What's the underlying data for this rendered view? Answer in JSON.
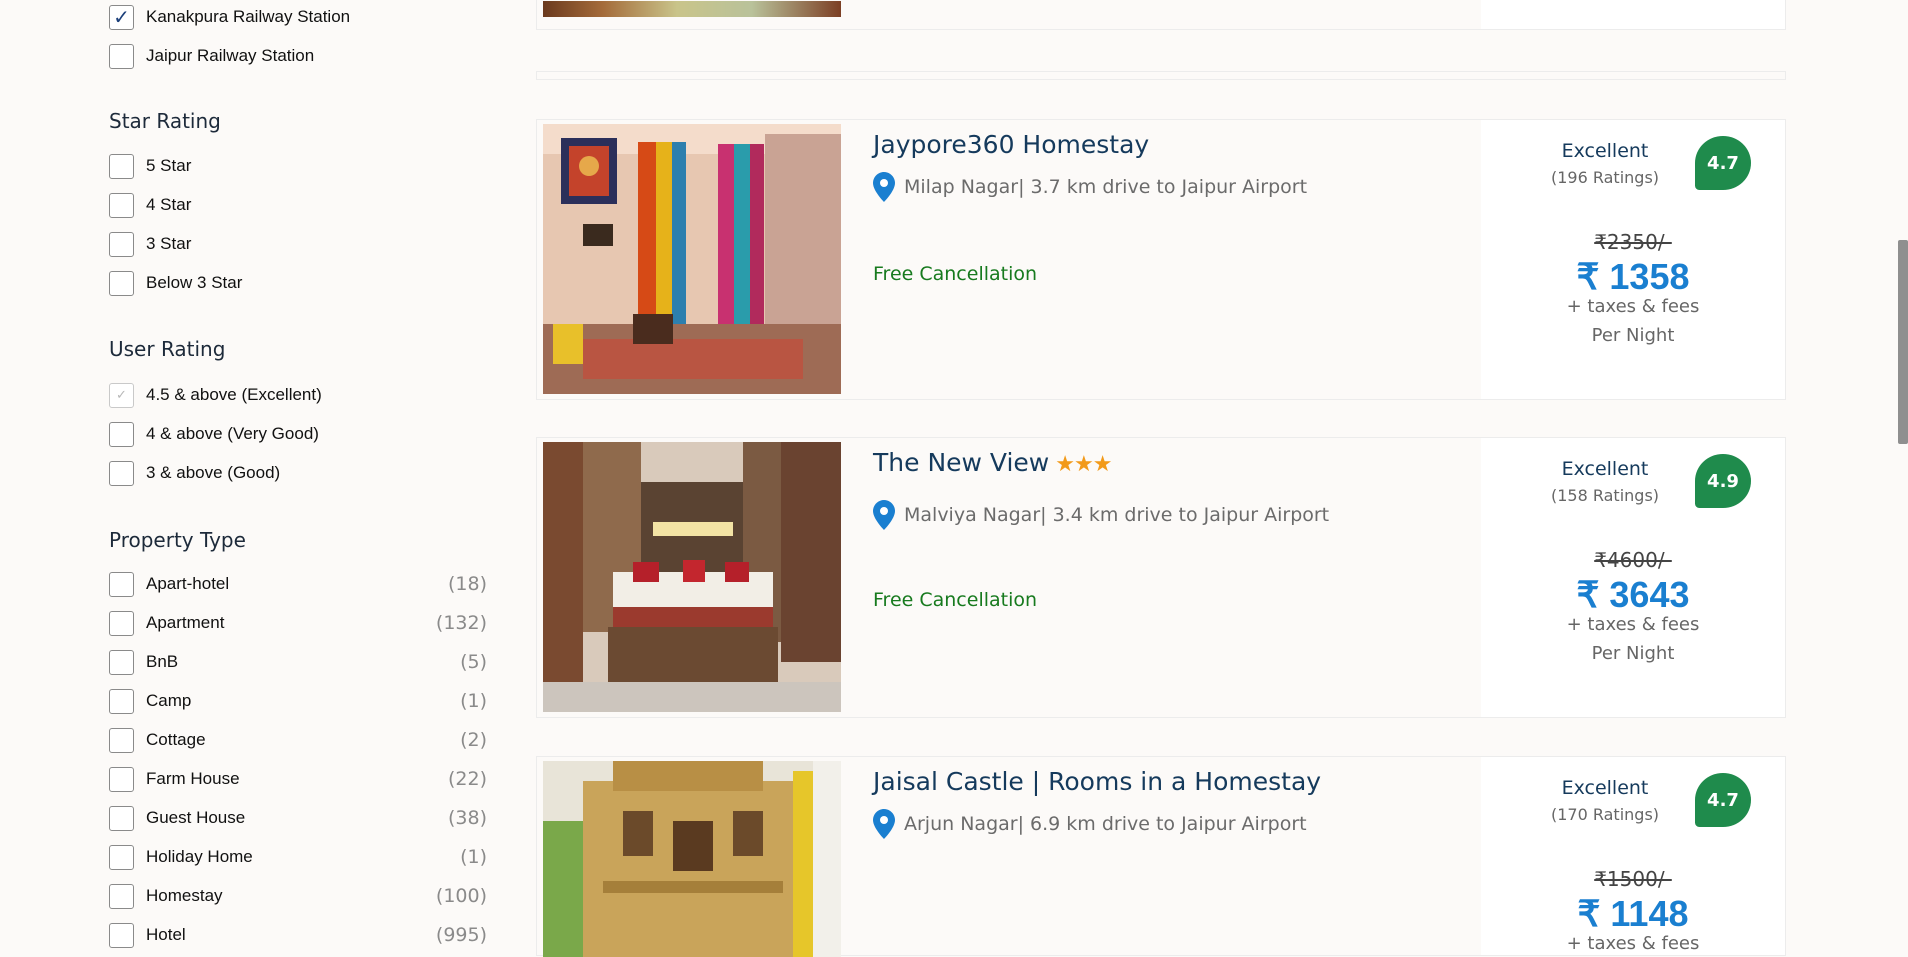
{
  "filters": {
    "station_items": [
      {
        "label": "Kanakpura Railway Station",
        "checked": true
      },
      {
        "label": "Jaipur Railway Station",
        "checked": false
      }
    ],
    "star_rating": {
      "title": "Star Rating",
      "items": [
        "5 Star",
        "4 Star",
        "3 Star",
        "Below 3 Star"
      ]
    },
    "user_rating": {
      "title": "User Rating",
      "items": [
        "4.5 & above (Excellent)",
        "4 & above (Very Good)",
        "3 & above (Good)"
      ]
    },
    "property_type": {
      "title": "Property Type",
      "items": [
        {
          "label": "Apart-hotel",
          "count": "(18)"
        },
        {
          "label": "Apartment",
          "count": "(132)"
        },
        {
          "label": "BnB",
          "count": "(5)"
        },
        {
          "label": "Camp",
          "count": "(1)"
        },
        {
          "label": "Cottage",
          "count": "(2)"
        },
        {
          "label": "Farm House",
          "count": "(22)"
        },
        {
          "label": "Guest House",
          "count": "(38)"
        },
        {
          "label": "Holiday Home",
          "count": "(1)"
        },
        {
          "label": "Homestay",
          "count": "(100)"
        },
        {
          "label": "Hotel",
          "count": "(995)"
        }
      ]
    },
    "check_mark": "✓"
  },
  "listings": [
    {
      "name": "Jaypore360 Homestay",
      "stars": "",
      "location": "Milap Nagar| 3.7 km drive to Jaipur Airport",
      "free_cancellation": "Free Cancellation",
      "rating_word": "Excellent",
      "rating_count": "(196 Ratings)",
      "score": "4.7",
      "old_price": "₹2350/-",
      "price": "₹ 1358",
      "taxes": "+ taxes & fees",
      "per_night": "Per Night"
    },
    {
      "name": "The New View",
      "stars": "★★★",
      "location": "Malviya Nagar| 3.4 km drive to Jaipur Airport",
      "free_cancellation": "Free Cancellation",
      "rating_word": "Excellent",
      "rating_count": "(158 Ratings)",
      "score": "4.9",
      "old_price": "₹4600/-",
      "price": "₹ 3643",
      "taxes": "+ taxes & fees",
      "per_night": "Per Night"
    },
    {
      "name": "Jaisal Castle | Rooms in a Homestay",
      "stars": "",
      "location": "Arjun Nagar| 6.9 km drive to Jaipur Airport",
      "free_cancellation": "",
      "rating_word": "Excellent",
      "rating_count": "(170 Ratings)",
      "score": "4.7",
      "old_price": "₹1500/-",
      "price": "₹ 1148",
      "taxes": "+ taxes & fees",
      "per_night": ""
    }
  ],
  "colors": {
    "accent": "#1a7fd0",
    "rating_green": "#1f8b4c",
    "free_cancel": "#177a1e",
    "title_navy": "#153a5c"
  },
  "icons": [
    "map-pin-icon",
    "checkbox-check-icon",
    "star-icon"
  ]
}
